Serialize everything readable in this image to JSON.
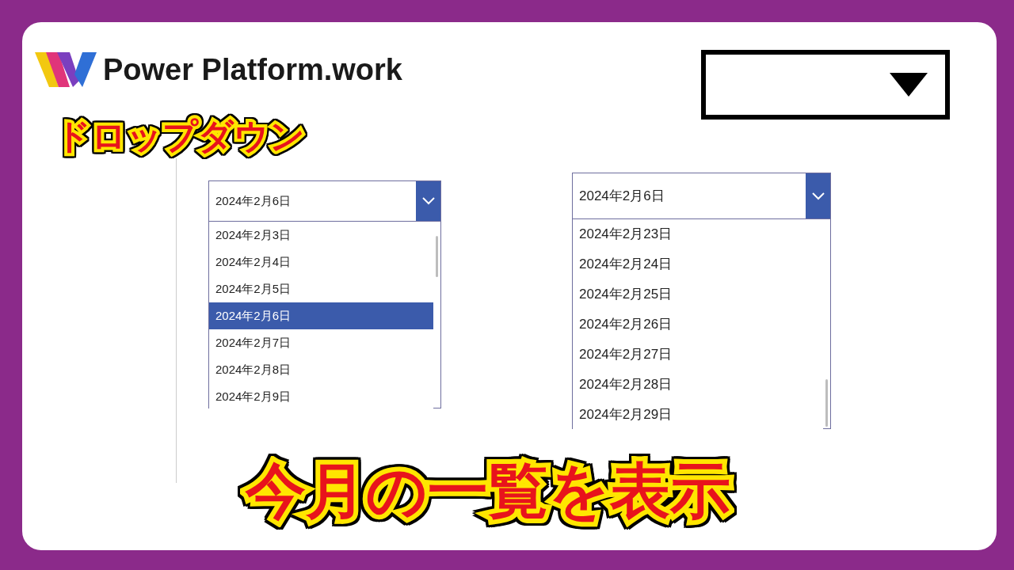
{
  "logo": {
    "text": "Power Platform.work"
  },
  "subtitle": "ドロップダウン",
  "dropdowns": [
    {
      "value": "2024年2月6日",
      "options": [
        {
          "label": "2024年2月3日",
          "selected": false
        },
        {
          "label": "2024年2月4日",
          "selected": false
        },
        {
          "label": "2024年2月5日",
          "selected": false
        },
        {
          "label": "2024年2月6日",
          "selected": true
        },
        {
          "label": "2024年2月7日",
          "selected": false
        },
        {
          "label": "2024年2月8日",
          "selected": false
        },
        {
          "label": "2024年2月9日",
          "selected": false
        }
      ]
    },
    {
      "value": "2024年2月6日",
      "options": [
        {
          "label": "2024年2月23日",
          "selected": false
        },
        {
          "label": "2024年2月24日",
          "selected": false
        },
        {
          "label": "2024年2月25日",
          "selected": false
        },
        {
          "label": "2024年2月26日",
          "selected": false
        },
        {
          "label": "2024年2月27日",
          "selected": false
        },
        {
          "label": "2024年2月28日",
          "selected": false
        },
        {
          "label": "2024年2月29日",
          "selected": false
        }
      ]
    }
  ],
  "headline": "今月の一覧を表示"
}
